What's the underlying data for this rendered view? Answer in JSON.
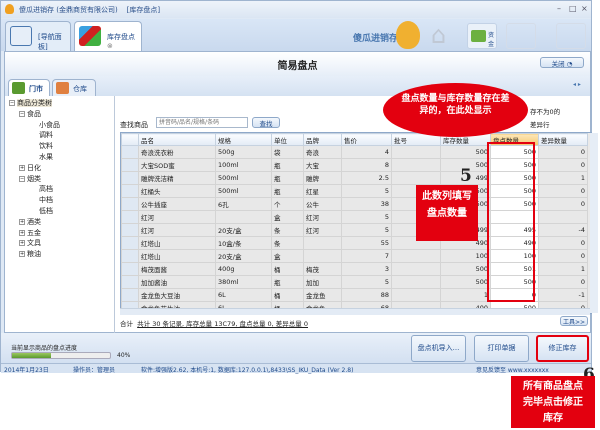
{
  "window": {
    "title": "傻瓜进销存 (金鼎商贸有限公司)",
    "module": "[库存盘点]",
    "min": "–",
    "max": "□",
    "close": "×"
  },
  "apptabs": [
    {
      "label": "[导航面板]"
    },
    {
      "label": "库存盘点"
    }
  ],
  "brand": "傻瓜进销存",
  "toolbar": {
    "funds_label": "资金"
  },
  "page": {
    "title": "简易盘点",
    "close_label": "关闭"
  },
  "store_tabs": [
    {
      "label": "门市"
    },
    {
      "label": "仓库"
    }
  ],
  "tree": [
    {
      "label": "商品分类树",
      "level": 0,
      "exp": "−"
    },
    {
      "label": "食品",
      "level": 1,
      "exp": "−"
    },
    {
      "label": "小食品",
      "level": 2
    },
    {
      "label": "调料",
      "level": 2
    },
    {
      "label": "饮料",
      "level": 2
    },
    {
      "label": "水果",
      "level": 2
    },
    {
      "label": "日化",
      "level": 1,
      "exp": "+"
    },
    {
      "label": "烟类",
      "level": 1,
      "exp": "−"
    },
    {
      "label": "高档",
      "level": 2
    },
    {
      "label": "中档",
      "level": 2
    },
    {
      "label": "低档",
      "level": 2
    },
    {
      "label": "酒类",
      "level": 1,
      "exp": "+"
    },
    {
      "label": "五金",
      "level": 1,
      "exp": "+"
    },
    {
      "label": "文具",
      "level": 1,
      "exp": "+"
    },
    {
      "label": "粮油",
      "level": 1,
      "exp": "+"
    }
  ],
  "search": {
    "label": "查找商品",
    "placeholder": "拼音码/品名/规格/条码",
    "button": "查找"
  },
  "filter_text": [
    "存不为0的",
    "差异行"
  ],
  "grid": {
    "columns": [
      "品名",
      "规格",
      "单位",
      "品牌",
      "售价",
      "批号",
      "库存数量",
      "盘点数量",
      "差异数量"
    ],
    "rows": [
      [
        "奇浪洗衣粉",
        "500g",
        "袋",
        "奇浪",
        "4",
        "",
        "500",
        "500",
        "0"
      ],
      [
        "大宝SOD蜜",
        "100ml",
        "瓶",
        "大宝",
        "8",
        "",
        "500",
        "500",
        "0"
      ],
      [
        "雕牌洗洁精",
        "500ml",
        "瓶",
        "雕牌",
        "2.5",
        "",
        "499",
        "500",
        "1"
      ],
      [
        "红桶头",
        "500ml",
        "瓶",
        "红星",
        "5",
        "",
        "500",
        "500",
        "0"
      ],
      [
        "公牛插座",
        "6孔",
        "个",
        "公牛",
        "38",
        "",
        "500",
        "500",
        "0"
      ],
      [
        "红河",
        "",
        "盒",
        "红河",
        "5",
        "",
        "",
        "",
        ""
      ],
      [
        "红河",
        "20支/盒",
        "条",
        "红河",
        "5",
        "",
        "499",
        "495",
        "-4"
      ],
      [
        "红塔山",
        "10盒/条",
        "条",
        "",
        "55",
        "",
        "490",
        "490",
        "0"
      ],
      [
        "红塔山",
        "20支/盒",
        "盒",
        "",
        "7",
        "",
        "100",
        "100",
        "0"
      ],
      [
        "梅茂面酱",
        "400g",
        "桶",
        "梅茂",
        "3",
        "",
        "500",
        "501",
        "1"
      ],
      [
        "加加酱油",
        "380ml",
        "瓶",
        "加加",
        "5",
        "",
        "500",
        "500",
        "0"
      ],
      [
        "金龙鱼大豆油",
        "6L",
        "桶",
        "金龙鱼",
        "88",
        "",
        "1",
        "0",
        "-1"
      ],
      [
        "金龙鱼花生油",
        "6L",
        "桶",
        "金龙鱼",
        "68",
        "",
        "400",
        "500",
        "0"
      ]
    ]
  },
  "summary": {
    "label": "合计",
    "text": "共计 30 条记录, 库存总量 13C79, 盘点总量 0, 差异总量 0",
    "tools": "工具>>"
  },
  "progress": {
    "label": "当前显示商品的盘点进度",
    "percent": 40,
    "text": "40%"
  },
  "buttons": {
    "import": "盘点机导入...",
    "print": "打印单据",
    "fix": "修正库存"
  },
  "status": {
    "date": "2014年1月23日",
    "operator": "操作员：管理员",
    "software": "软件:增强版2.62, 本机号:1, 数据库:127.0.0.1\\,8433\\SS_IKU_Data (Ver 2.8)",
    "feedback": "意见反馈至 www.xxxxxxx"
  },
  "annotations": {
    "bubble": "盘点数量与库存数量存在差异的，在此处显示",
    "step5": "5",
    "step5_text": "此数列填写盘点数量",
    "step6": "6",
    "step6_text": "所有商品盘点完毕点击修正库存"
  }
}
